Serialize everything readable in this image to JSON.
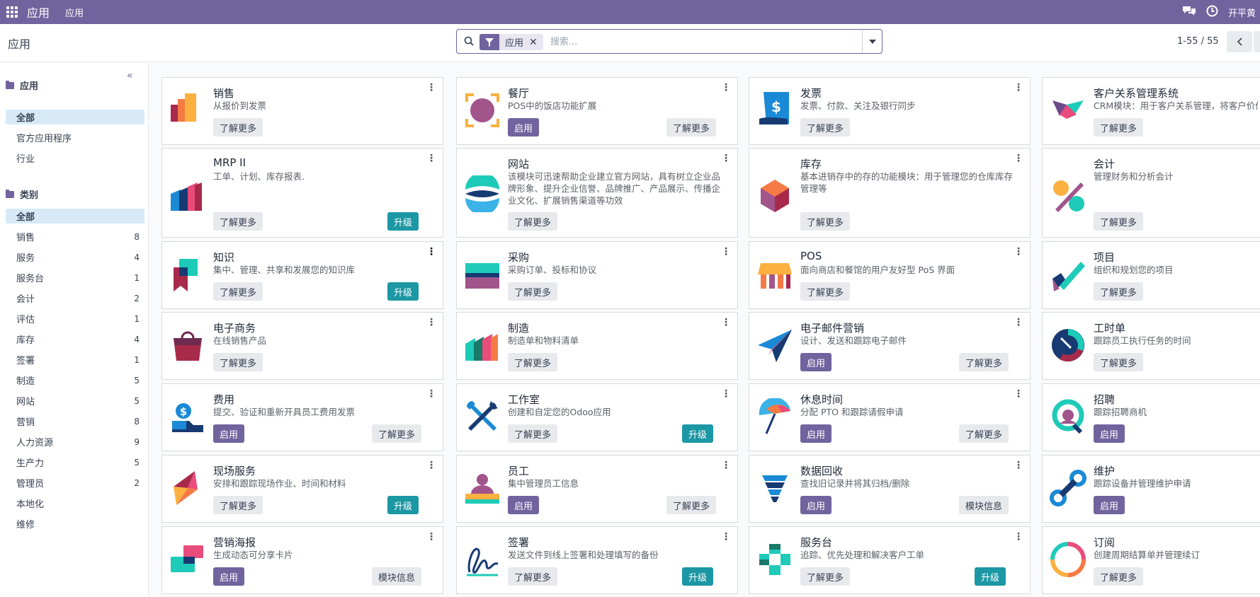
{
  "navbar": {
    "brand": "应用",
    "menu": "应用",
    "user": "开平黄"
  },
  "control": {
    "title": "应用",
    "facet_label": "应用",
    "facet_remove": "✕",
    "search_placeholder": "搜索...",
    "pager": "1-55 / 55"
  },
  "sidebar": {
    "collapse": "«",
    "apps_header": "应用",
    "apps_items": [
      {
        "label": "全部"
      },
      {
        "label": "官方应用程序"
      },
      {
        "label": "行业"
      }
    ],
    "cat_header": "类别",
    "cat_items": [
      {
        "label": "全部",
        "count": ""
      },
      {
        "label": "销售",
        "count": "8"
      },
      {
        "label": "服务",
        "count": "4"
      },
      {
        "label": "服务台",
        "count": "1"
      },
      {
        "label": "会计",
        "count": "2"
      },
      {
        "label": "评估",
        "count": "1"
      },
      {
        "label": "库存",
        "count": "4"
      },
      {
        "label": "签署",
        "count": "1"
      },
      {
        "label": "制造",
        "count": "5"
      },
      {
        "label": "网站",
        "count": "5"
      },
      {
        "label": "营销",
        "count": "8"
      },
      {
        "label": "人力资源",
        "count": "9"
      },
      {
        "label": "生产力",
        "count": "5"
      },
      {
        "label": "管理员",
        "count": "2"
      },
      {
        "label": "本地化",
        "count": ""
      },
      {
        "label": "维修",
        "count": ""
      }
    ]
  },
  "buttons": {
    "learn_more": "了解更多",
    "enable": "启用",
    "upgrade": "升级",
    "module_info": "模块信息"
  },
  "cards": [
    {
      "name": "销售",
      "desc": "从报价到发票"
    },
    {
      "name": "餐厅",
      "desc": "POS中的饭店功能扩展"
    },
    {
      "name": "发票",
      "desc": "发票、付款、关注及银行同步"
    },
    {
      "name": "客户关系管理系统",
      "desc": "CRM模块：用于客户关系管理，将客户价值"
    },
    {
      "name": "MRP II",
      "desc": "工单、计划、库存报表."
    },
    {
      "name": "网站",
      "desc": "该模块可迅速帮助企业建立官方网站，具有树立企业品牌形象、提升企业信誉、品牌推广、产品展示、传播企业文化、扩展销售渠道等功效"
    },
    {
      "name": "库存",
      "desc": "基本进销存中的存的功能模块：用于管理您的仓库库存管理等"
    },
    {
      "name": "会计",
      "desc": "管理财务和分析会计"
    },
    {
      "name": "知识",
      "desc": "集中、管理、共享和发展您的知识库"
    },
    {
      "name": "采购",
      "desc": "采购订单、投标和协议"
    },
    {
      "name": "POS",
      "desc": "面向商店和餐馆的用户友好型 PoS 界面"
    },
    {
      "name": "项目",
      "desc": "组织和规划您的项目"
    },
    {
      "name": "电子商务",
      "desc": "在线销售产品"
    },
    {
      "name": "制造",
      "desc": "制造单和物料清单"
    },
    {
      "name": "电子邮件营销",
      "desc": "设计、发送和跟踪电子邮件"
    },
    {
      "name": "工时单",
      "desc": "跟踪员工执行任务的时间"
    },
    {
      "name": "费用",
      "desc": "提交、验证和重新开具员工费用发票"
    },
    {
      "name": "工作室",
      "desc": "创建和自定您的Odoo应用"
    },
    {
      "name": "休息时间",
      "desc": "分配 PTO 和跟踪请假申请"
    },
    {
      "name": "招聘",
      "desc": "跟踪招聘商机"
    },
    {
      "name": "现场服务",
      "desc": "安排和跟踪现场作业、时间和材料"
    },
    {
      "name": "员工",
      "desc": "集中管理员工信息"
    },
    {
      "name": "数据回收",
      "desc": "查找旧记录并将其归档/删除"
    },
    {
      "name": "维护",
      "desc": "跟踪设备并管理维护申请"
    },
    {
      "name": "营销海报",
      "desc": "生成动态可分享卡片"
    },
    {
      "name": "签署",
      "desc": "发送文件到线上签署和处理填写的备份"
    },
    {
      "name": "服务台",
      "desc": "追踪、优先处理和解决客户工单"
    },
    {
      "name": "订阅",
      "desc": "创建周期结算单并管理续订"
    }
  ]
}
